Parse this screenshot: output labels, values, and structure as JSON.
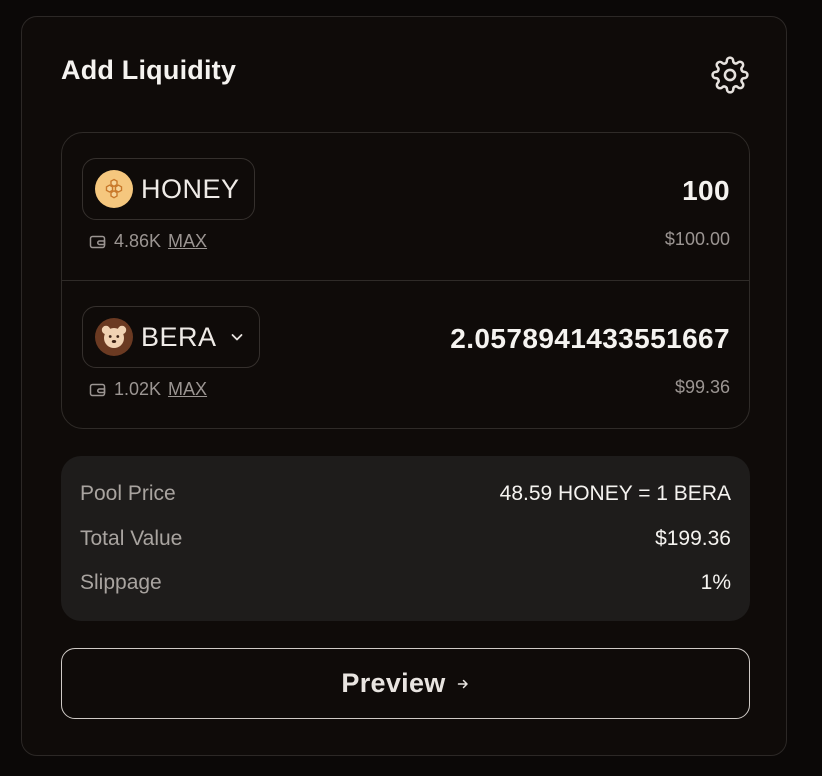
{
  "header": {
    "title": "Add Liquidity",
    "settings_icon": "gear-icon"
  },
  "tokens": [
    {
      "symbol": "HONEY",
      "icon": "honey-token-icon",
      "balance": "4.86K",
      "max_label": "MAX",
      "amount": "100",
      "usd_value": "$100.00",
      "has_dropdown": false
    },
    {
      "symbol": "BERA",
      "icon": "bera-token-icon",
      "balance": "1.02K",
      "max_label": "MAX",
      "amount": "2.0578941433551667",
      "usd_value": "$99.36",
      "has_dropdown": true
    }
  ],
  "summary": {
    "pool_price_label": "Pool Price",
    "pool_price_value": "48.59 HONEY = 1 BERA",
    "total_value_label": "Total Value",
    "total_value_value": "$199.36",
    "slippage_label": "Slippage",
    "slippage_value": "1%"
  },
  "preview_button": {
    "label": "Preview"
  },
  "colors": {
    "background": "#0b0807",
    "card_border": "#2c2826",
    "honey_icon": "#f5c77e",
    "bera_icon": "#6b3a22",
    "summary_bg": "#1e1c1b"
  }
}
